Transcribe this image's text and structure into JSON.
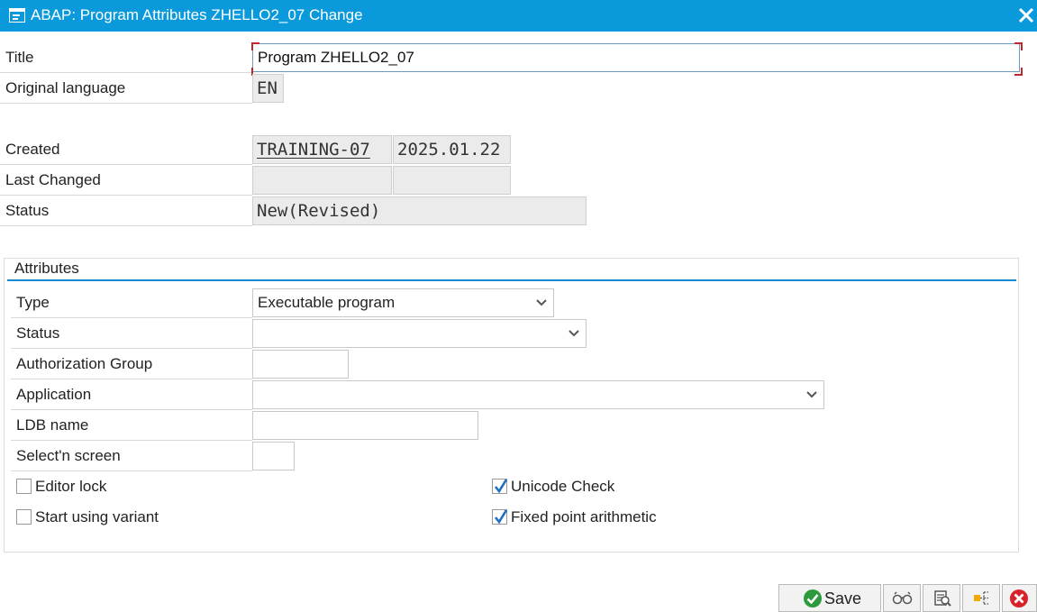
{
  "window": {
    "title": "ABAP: Program Attributes ZHELLO2_07 Change",
    "icons": {
      "window": "window-menu-icon",
      "close": "close-icon"
    }
  },
  "header": {
    "title_label": "Title",
    "title_value": "Program ZHELLO2_07",
    "orig_lang_label": "Original language",
    "orig_lang_value": "EN",
    "created_label": "Created",
    "created_user": "TRAINING-07",
    "created_date": "2025.01.22",
    "last_changed_label": "Last Changed",
    "last_changed_user": "",
    "last_changed_date": "",
    "status_label": "Status",
    "status_value": "New(Revised)"
  },
  "attributes": {
    "group_title": "Attributes",
    "type_label": "Type",
    "type_value": "Executable program",
    "status_label": "Status",
    "status_value": "",
    "auth_group_label": "Authorization Group",
    "auth_group_value": "",
    "application_label": "Application",
    "application_value": "",
    "ldb_label": "LDB name",
    "ldb_value": "",
    "selscreen_label": "Select'n screen",
    "selscreen_value": "",
    "checkboxes": [
      {
        "label": "Editor lock",
        "checked": false
      },
      {
        "label": "Start using variant",
        "checked": false
      },
      {
        "label": "Unicode Check",
        "checked": true
      },
      {
        "label": "Fixed point arithmetic",
        "checked": true
      }
    ]
  },
  "footer": {
    "save_label": "Save",
    "icons": [
      "check-icon",
      "glasses-icon",
      "document-magnify-icon",
      "hierarchy-icon",
      "cancel-icon"
    ],
    "colors": {
      "accent": "#0a9adc",
      "save_green": "#2e9a3e",
      "cancel_red": "#d8232a"
    }
  }
}
